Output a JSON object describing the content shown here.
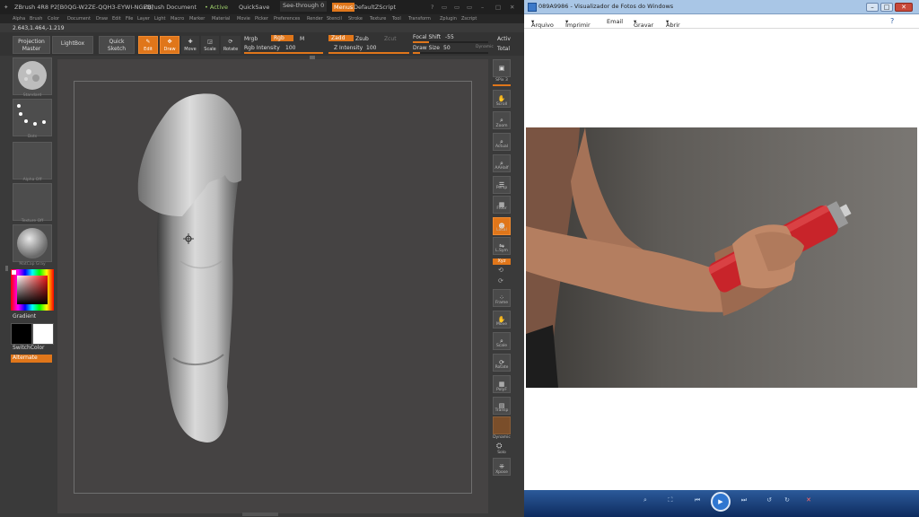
{
  "zbrush": {
    "title_parts": [
      "ZBrush 4R8 P2[B0QG-W2ZE-QQH3-EYWI-NGFQ]",
      "ZBrush Document",
      "• Active",
      "QuickSave",
      "See-through  0",
      "Menus",
      "DefaultZScript"
    ],
    "menu_items": [
      "Alpha",
      "Brush",
      "Color",
      "Document",
      "Draw",
      "Edit",
      "File",
      "Layer",
      "Light",
      "Macro",
      "Marker",
      "Material",
      "Movie",
      "Picker",
      "Preferences",
      "Render",
      "Stencil",
      "Stroke",
      "Texture",
      "Tool",
      "Transform",
      "Zplugin",
      "Zscript"
    ],
    "coords": "2.643,1.464,-1.219",
    "toolbar": {
      "projection_master": "Projection\nMaster",
      "lightbox": "LightBox",
      "quick_sketch": "Quick\nSketch",
      "edit": "Edit",
      "draw": "Draw",
      "move": "Move",
      "scale": "Scale",
      "rotate": "Rotate",
      "mrgb": "Mrgb",
      "rgb": "Rgb",
      "m": "M",
      "rgb_intensity_label": "Rgb Intensity",
      "rgb_intensity_value": "100",
      "zadd": "Zadd",
      "zsub": "Zsub",
      "zcut": "Zcut",
      "z_intensity_label": "Z Intensity",
      "z_intensity_value": "100",
      "focal_shift_label": "Focal Shift",
      "focal_shift_value": "-55",
      "draw_size_label": "Draw Size",
      "draw_size_value": "50",
      "dynamic": "Dynamic",
      "active": "Activ",
      "total": "Total"
    },
    "left_shelf": {
      "brush_caption": "Standard",
      "stroke_caption": "Dots",
      "alpha_caption": "Alpha Off",
      "texture_caption": "Texture Off",
      "material_caption": "MatCap Gray",
      "gradient": "Gradient",
      "switch_color": "SwitchColor",
      "alternate": "Alternate"
    },
    "right_shelf": {
      "spix_label": "SPix",
      "spix_value": "3",
      "buttons": [
        "Scroll",
        "Zoom",
        "Actual",
        "AAHalf",
        "Persp",
        "Floor",
        "Local",
        "L.Sym",
        "Xyz",
        "Frame",
        "Move",
        "Scale",
        "Rotate",
        "PolyF",
        "Transp",
        "Dynamic",
        "Solo",
        "Xpose"
      ]
    }
  },
  "photo_viewer": {
    "title": "089A9986 - Visualizador de Fotos do Windows",
    "menu": [
      "Arquivo",
      "Imprimir",
      "Email",
      "Gravar",
      "Abrir"
    ],
    "window_buttons": [
      "minimize",
      "maximize",
      "close"
    ]
  },
  "colors": {
    "zbrush_orange": "#e0761a",
    "zbrush_bg": "#3a3a3a",
    "canvas_bg": "#454343",
    "viewer_bar": "#1f4a86",
    "spray_can": "#c8242a"
  }
}
